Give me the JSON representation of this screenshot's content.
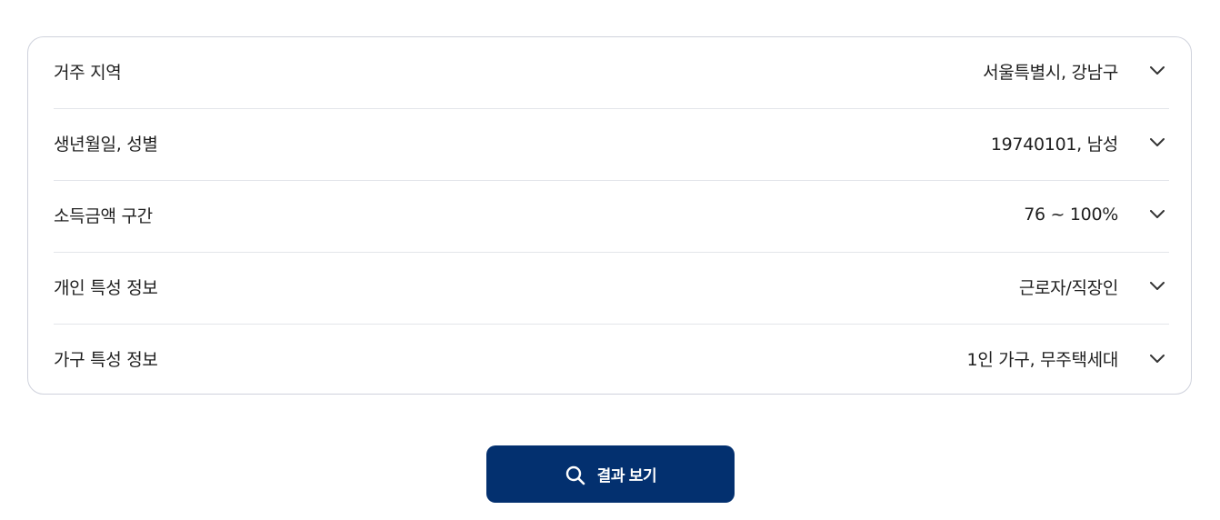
{
  "filters": {
    "rows": [
      {
        "label": "거주 지역",
        "value": "서울특별시, 강남구"
      },
      {
        "label": "생년월일, 성별",
        "value": "19740101, 남성"
      },
      {
        "label": "소득금액 구간",
        "value": "76 ~ 100%"
      },
      {
        "label": "개인 특성 정보",
        "value": "근로자/직장인"
      },
      {
        "label": "가구 특성 정보",
        "value": "1인 가구, 무주택세대"
      }
    ],
    "expand_icon": "chevron-down-icon"
  },
  "action": {
    "label": "결과 보기",
    "icon": "search-icon",
    "color": "#03306f"
  }
}
